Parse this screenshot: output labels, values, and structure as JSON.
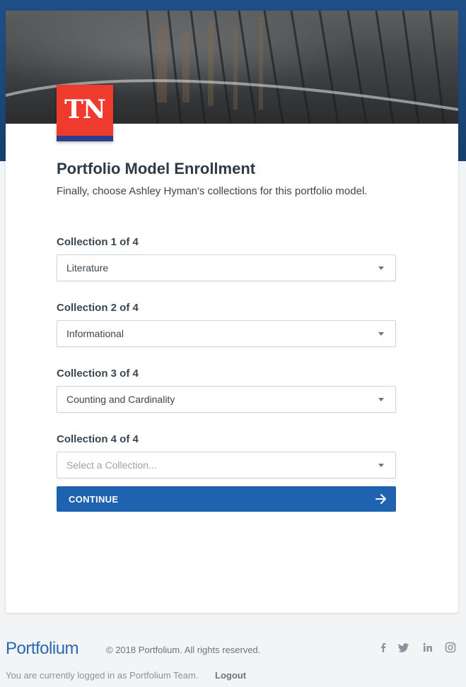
{
  "header": {
    "logo_text": "TN"
  },
  "main": {
    "title": "Portfolio Model Enrollment",
    "subtitle": "Finally, choose Ashley Hyman's collections for this portfolio model."
  },
  "collections": [
    {
      "label": "Collection 1 of 4",
      "value": "Literature"
    },
    {
      "label": "Collection 2 of 4",
      "value": "Informational"
    },
    {
      "label": "Collection 3 of 4",
      "value": "Counting and Cardinality"
    },
    {
      "label": "Collection 4 of 4",
      "value": "",
      "placeholder": "Select a Collection..."
    }
  ],
  "actions": {
    "continue_label": "CONTINUE"
  },
  "footer": {
    "brand": "Portfolium",
    "copyright": "© 2018 Portfolium. All rights reserved.",
    "logged_in_text": "You are currently logged in as Portfolium Team.",
    "logout_label": "Logout",
    "social_icons": [
      "facebook-icon",
      "twitter-icon",
      "linkedin-icon",
      "instagram-icon"
    ]
  },
  "colors": {
    "brand_blue": "#1f63b0",
    "header_blue": "#1f4f86",
    "tn_red": "#ee3b2e",
    "tn_stripe": "#2f3d86"
  }
}
